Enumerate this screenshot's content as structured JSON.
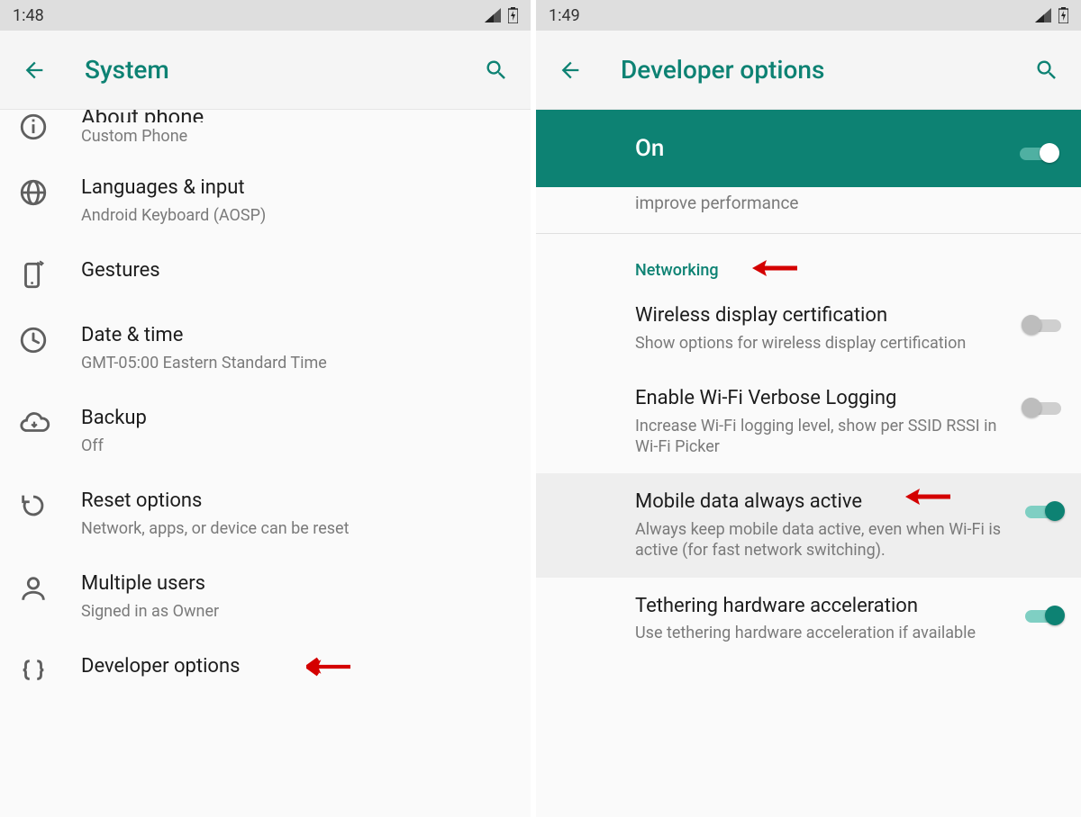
{
  "left": {
    "status_time": "1:48",
    "title": "System",
    "items": {
      "about": {
        "title": "About phone",
        "sub": "Custom Phone"
      },
      "lang": {
        "title": "Languages & input",
        "sub": "Android Keyboard (AOSP)"
      },
      "gestures": {
        "title": "Gestures"
      },
      "datetime": {
        "title": "Date & time",
        "sub": "GMT-05:00 Eastern Standard Time"
      },
      "backup": {
        "title": "Backup",
        "sub": "Off"
      },
      "reset": {
        "title": "Reset options",
        "sub": "Network, apps, or device can be reset"
      },
      "users": {
        "title": "Multiple users",
        "sub": "Signed in as Owner"
      },
      "dev": {
        "title": "Developer options"
      }
    }
  },
  "right": {
    "status_time": "1:49",
    "title": "Developer options",
    "on_label": "On",
    "partial_sub": "improve performance",
    "section": "Networking",
    "items": {
      "wdc": {
        "title": "Wireless display certification",
        "sub": "Show options for wireless display certification"
      },
      "wifiverbose": {
        "title": "Enable Wi-Fi Verbose Logging",
        "sub": "Increase Wi-Fi logging level, show per SSID RSSI in Wi-Fi Picker"
      },
      "mobiledata": {
        "title": "Mobile data always active",
        "sub": "Always keep mobile data active, even when Wi-Fi is active (for fast network switching)."
      },
      "tether": {
        "title": "Tethering hardware acceleration",
        "sub": "Use tethering hardware acceleration if available"
      }
    }
  }
}
